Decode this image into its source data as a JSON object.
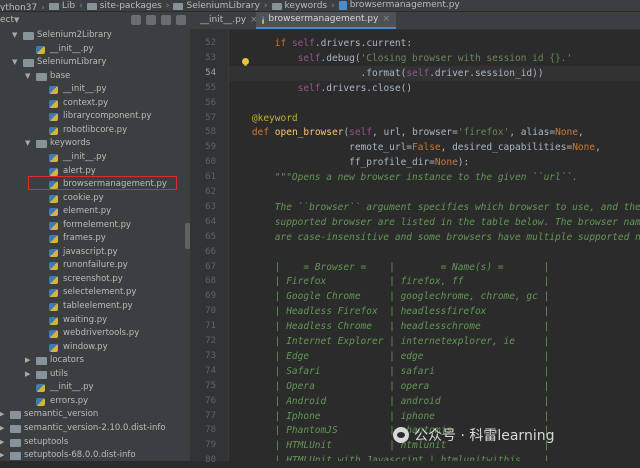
{
  "breadcrumb": [
    "ython37",
    "Lib",
    "site-packages",
    "SeleniumLibrary",
    "keywords",
    "browsermanagement.py"
  ],
  "project_panel": {
    "label": "ect",
    "tree": [
      {
        "label": "Selenium2Library",
        "type": "package",
        "expanded": true
      },
      {
        "label": "__init__.py",
        "type": "file"
      },
      {
        "label": "SeleniumLibrary",
        "type": "package",
        "expanded": true
      },
      {
        "label": "base",
        "type": "package",
        "expanded": true
      },
      {
        "label": "__init__.py",
        "type": "file"
      },
      {
        "label": "context.py",
        "type": "file"
      },
      {
        "label": "librarycomponent.py",
        "type": "file"
      },
      {
        "label": "robotlibcore.py",
        "type": "file"
      },
      {
        "label": "keywords",
        "type": "package",
        "expanded": true
      },
      {
        "label": "__init__.py",
        "type": "file"
      },
      {
        "label": "alert.py",
        "type": "file"
      },
      {
        "label": "browsermanagement.py",
        "type": "file",
        "selected": true
      },
      {
        "label": "cookie.py",
        "type": "file"
      },
      {
        "label": "element.py",
        "type": "file"
      },
      {
        "label": "formelement.py",
        "type": "file"
      },
      {
        "label": "frames.py",
        "type": "file"
      },
      {
        "label": "javascript.py",
        "type": "file"
      },
      {
        "label": "runonfailure.py",
        "type": "file"
      },
      {
        "label": "screenshot.py",
        "type": "file"
      },
      {
        "label": "selectelement.py",
        "type": "file"
      },
      {
        "label": "tableelement.py",
        "type": "file"
      },
      {
        "label": "waiting.py",
        "type": "file"
      },
      {
        "label": "webdrivertools.py",
        "type": "file"
      },
      {
        "label": "window.py",
        "type": "file"
      },
      {
        "label": "locators",
        "type": "package",
        "expanded": false
      },
      {
        "label": "utils",
        "type": "package",
        "expanded": false
      },
      {
        "label": "__init__.py",
        "type": "file"
      },
      {
        "label": "errors.py",
        "type": "file"
      },
      {
        "label": "semantic_version",
        "type": "package",
        "expanded": false
      },
      {
        "label": "semantic_version-2.10.0.dist-info",
        "type": "package",
        "expanded": false
      },
      {
        "label": "setuptools",
        "type": "package",
        "expanded": false
      },
      {
        "label": "setuptools-68.0.0.dist-info",
        "type": "package",
        "expanded": false
      }
    ]
  },
  "tabs": [
    {
      "label": "__init__.py",
      "active": false
    },
    {
      "label": "browsermanagement.py",
      "active": true
    }
  ],
  "editor": {
    "current_line": "54",
    "lines": [
      {
        "n": "52",
        "code": "        if self.drivers.current:"
      },
      {
        "n": "53",
        "code": "            self.debug('Closing browser with session id {}.'"
      },
      {
        "n": "54",
        "code": "                       .format(self.driver.session_id))"
      },
      {
        "n": "55",
        "code": "            self.drivers.close()"
      },
      {
        "n": "56",
        "code": ""
      },
      {
        "n": "57",
        "code": "    @keyword"
      },
      {
        "n": "58",
        "code": "    def open_browser(self, url, browser='firefox', alias=None,"
      },
      {
        "n": "59",
        "code": "                     remote_url=False, desired_capabilities=None,"
      },
      {
        "n": "60",
        "code": "                     ff_profile_dir=None):"
      },
      {
        "n": "61",
        "code": "        \"\"\"Opens a new browser instance to the given ``url``."
      },
      {
        "n": "62",
        "code": ""
      },
      {
        "n": "63",
        "code": "        The ``browser`` argument specifies which browser to use, and the"
      },
      {
        "n": "64",
        "code": "        supported browser are listed in the table below. The browser names"
      },
      {
        "n": "65",
        "code": "        are case-insensitive and some browsers have multiple supported names."
      },
      {
        "n": "66",
        "code": ""
      },
      {
        "n": "67",
        "code": "        |    = Browser =    |        = Name(s) =       |"
      },
      {
        "n": "68",
        "code": "        | Firefox           | firefox, ff              |"
      },
      {
        "n": "69",
        "code": "        | Google Chrome     | googlechrome, chrome, gc |"
      },
      {
        "n": "70",
        "code": "        | Headless Firefox  | headlessfirefox          |"
      },
      {
        "n": "71",
        "code": "        | Headless Chrome   | headlesschrome           |"
      },
      {
        "n": "72",
        "code": "        | Internet Explorer | internetexplorer, ie     |"
      },
      {
        "n": "73",
        "code": "        | Edge              | edge                     |"
      },
      {
        "n": "74",
        "code": "        | Safari            | safari                   |"
      },
      {
        "n": "75",
        "code": "        | Opera             | opera                    |"
      },
      {
        "n": "76",
        "code": "        | Android           | android                  |"
      },
      {
        "n": "77",
        "code": "        | Iphone            | iphone                   |"
      },
      {
        "n": "78",
        "code": "        | PhantomJS         | phantomjs                |"
      },
      {
        "n": "79",
        "code": "        | HTMLUnit          | htmlunit                 |"
      },
      {
        "n": "80",
        "code": "        | HTMLUnit with Javascript | htmlunitwithjs    |"
      }
    ]
  },
  "watermark": {
    "text": "公众号 · 科雷learning",
    "icon": "wechat-icon"
  },
  "colors": {
    "keyword": "#cc7832",
    "string": "#6a8759",
    "docstring": "#629755",
    "self": "#94558d",
    "function": "#ffc66d",
    "decorator": "#bbb529",
    "selection_border": "#e02a2a"
  }
}
